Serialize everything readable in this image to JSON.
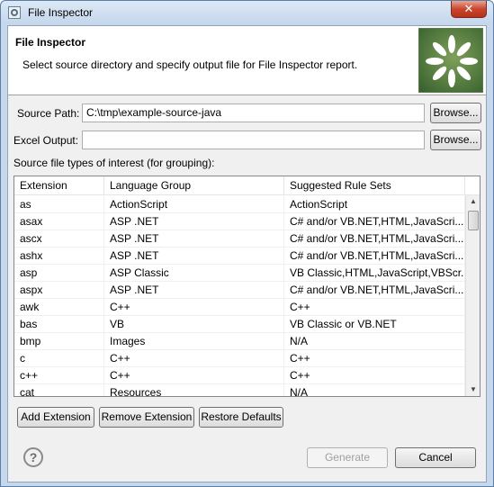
{
  "window": {
    "title": "File Inspector",
    "close_label": "✕"
  },
  "banner": {
    "title": "File Inspector",
    "description": "Select source directory and specify output file for File Inspector report."
  },
  "source_path": {
    "label": "Source Path:",
    "value": "C:\\tmp\\example-source-java",
    "browse_label": "Browse..."
  },
  "excel_output": {
    "label": "Excel Output:",
    "value": "",
    "browse_label": "Browse..."
  },
  "filetypes_label": "Source file types of interest (for grouping):",
  "table": {
    "columns": [
      "Extension",
      "Language Group",
      "Suggested Rule Sets"
    ],
    "rows": [
      [
        "as",
        "ActionScript",
        "ActionScript"
      ],
      [
        "asax",
        "ASP .NET",
        "C# and/or VB.NET,HTML,JavaScri..."
      ],
      [
        "ascx",
        "ASP .NET",
        "C# and/or VB.NET,HTML,JavaScri..."
      ],
      [
        "ashx",
        "ASP .NET",
        "C# and/or VB.NET,HTML,JavaScri..."
      ],
      [
        "asp",
        "ASP Classic",
        "VB Classic,HTML,JavaScript,VBScr..."
      ],
      [
        "aspx",
        "ASP .NET",
        "C# and/or VB.NET,HTML,JavaScri..."
      ],
      [
        "awk",
        "C++",
        "C++"
      ],
      [
        "bas",
        "VB",
        "VB Classic or VB.NET"
      ],
      [
        "bmp",
        "Images",
        "N/A"
      ],
      [
        "c",
        "C++",
        "C++"
      ],
      [
        "c++",
        "C++",
        "C++"
      ],
      [
        "cat",
        "Resources",
        "N/A"
      ]
    ]
  },
  "actions": {
    "add": "Add Extension",
    "remove": "Remove Extension",
    "restore": "Restore Defaults"
  },
  "footer": {
    "help": "?",
    "generate": "Generate",
    "cancel": "Cancel"
  },
  "colors": {
    "logo_bg": "#4a7a3a",
    "window_frame": "#c7d8ec",
    "close": "#c9462e"
  }
}
